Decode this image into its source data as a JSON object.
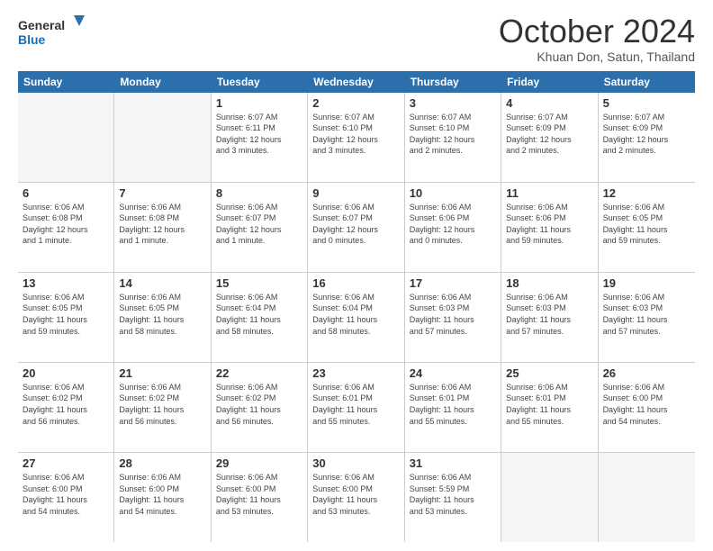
{
  "logo": {
    "line1": "General",
    "line2": "Blue"
  },
  "title": "October 2024",
  "subtitle": "Khuan Don, Satun, Thailand",
  "days_of_week": [
    "Sunday",
    "Monday",
    "Tuesday",
    "Wednesday",
    "Thursday",
    "Friday",
    "Saturday"
  ],
  "weeks": [
    [
      {
        "day": "",
        "text": ""
      },
      {
        "day": "",
        "text": ""
      },
      {
        "day": "1",
        "text": "Sunrise: 6:07 AM\nSunset: 6:11 PM\nDaylight: 12 hours\nand 3 minutes."
      },
      {
        "day": "2",
        "text": "Sunrise: 6:07 AM\nSunset: 6:10 PM\nDaylight: 12 hours\nand 3 minutes."
      },
      {
        "day": "3",
        "text": "Sunrise: 6:07 AM\nSunset: 6:10 PM\nDaylight: 12 hours\nand 2 minutes."
      },
      {
        "day": "4",
        "text": "Sunrise: 6:07 AM\nSunset: 6:09 PM\nDaylight: 12 hours\nand 2 minutes."
      },
      {
        "day": "5",
        "text": "Sunrise: 6:07 AM\nSunset: 6:09 PM\nDaylight: 12 hours\nand 2 minutes."
      }
    ],
    [
      {
        "day": "6",
        "text": "Sunrise: 6:06 AM\nSunset: 6:08 PM\nDaylight: 12 hours\nand 1 minute."
      },
      {
        "day": "7",
        "text": "Sunrise: 6:06 AM\nSunset: 6:08 PM\nDaylight: 12 hours\nand 1 minute."
      },
      {
        "day": "8",
        "text": "Sunrise: 6:06 AM\nSunset: 6:07 PM\nDaylight: 12 hours\nand 1 minute."
      },
      {
        "day": "9",
        "text": "Sunrise: 6:06 AM\nSunset: 6:07 PM\nDaylight: 12 hours\nand 0 minutes."
      },
      {
        "day": "10",
        "text": "Sunrise: 6:06 AM\nSunset: 6:06 PM\nDaylight: 12 hours\nand 0 minutes."
      },
      {
        "day": "11",
        "text": "Sunrise: 6:06 AM\nSunset: 6:06 PM\nDaylight: 11 hours\nand 59 minutes."
      },
      {
        "day": "12",
        "text": "Sunrise: 6:06 AM\nSunset: 6:05 PM\nDaylight: 11 hours\nand 59 minutes."
      }
    ],
    [
      {
        "day": "13",
        "text": "Sunrise: 6:06 AM\nSunset: 6:05 PM\nDaylight: 11 hours\nand 59 minutes."
      },
      {
        "day": "14",
        "text": "Sunrise: 6:06 AM\nSunset: 6:05 PM\nDaylight: 11 hours\nand 58 minutes."
      },
      {
        "day": "15",
        "text": "Sunrise: 6:06 AM\nSunset: 6:04 PM\nDaylight: 11 hours\nand 58 minutes."
      },
      {
        "day": "16",
        "text": "Sunrise: 6:06 AM\nSunset: 6:04 PM\nDaylight: 11 hours\nand 58 minutes."
      },
      {
        "day": "17",
        "text": "Sunrise: 6:06 AM\nSunset: 6:03 PM\nDaylight: 11 hours\nand 57 minutes."
      },
      {
        "day": "18",
        "text": "Sunrise: 6:06 AM\nSunset: 6:03 PM\nDaylight: 11 hours\nand 57 minutes."
      },
      {
        "day": "19",
        "text": "Sunrise: 6:06 AM\nSunset: 6:03 PM\nDaylight: 11 hours\nand 57 minutes."
      }
    ],
    [
      {
        "day": "20",
        "text": "Sunrise: 6:06 AM\nSunset: 6:02 PM\nDaylight: 11 hours\nand 56 minutes."
      },
      {
        "day": "21",
        "text": "Sunrise: 6:06 AM\nSunset: 6:02 PM\nDaylight: 11 hours\nand 56 minutes."
      },
      {
        "day": "22",
        "text": "Sunrise: 6:06 AM\nSunset: 6:02 PM\nDaylight: 11 hours\nand 56 minutes."
      },
      {
        "day": "23",
        "text": "Sunrise: 6:06 AM\nSunset: 6:01 PM\nDaylight: 11 hours\nand 55 minutes."
      },
      {
        "day": "24",
        "text": "Sunrise: 6:06 AM\nSunset: 6:01 PM\nDaylight: 11 hours\nand 55 minutes."
      },
      {
        "day": "25",
        "text": "Sunrise: 6:06 AM\nSunset: 6:01 PM\nDaylight: 11 hours\nand 55 minutes."
      },
      {
        "day": "26",
        "text": "Sunrise: 6:06 AM\nSunset: 6:00 PM\nDaylight: 11 hours\nand 54 minutes."
      }
    ],
    [
      {
        "day": "27",
        "text": "Sunrise: 6:06 AM\nSunset: 6:00 PM\nDaylight: 11 hours\nand 54 minutes."
      },
      {
        "day": "28",
        "text": "Sunrise: 6:06 AM\nSunset: 6:00 PM\nDaylight: 11 hours\nand 54 minutes."
      },
      {
        "day": "29",
        "text": "Sunrise: 6:06 AM\nSunset: 6:00 PM\nDaylight: 11 hours\nand 53 minutes."
      },
      {
        "day": "30",
        "text": "Sunrise: 6:06 AM\nSunset: 6:00 PM\nDaylight: 11 hours\nand 53 minutes."
      },
      {
        "day": "31",
        "text": "Sunrise: 6:06 AM\nSunset: 5:59 PM\nDaylight: 11 hours\nand 53 minutes."
      },
      {
        "day": "",
        "text": ""
      },
      {
        "day": "",
        "text": ""
      }
    ]
  ]
}
